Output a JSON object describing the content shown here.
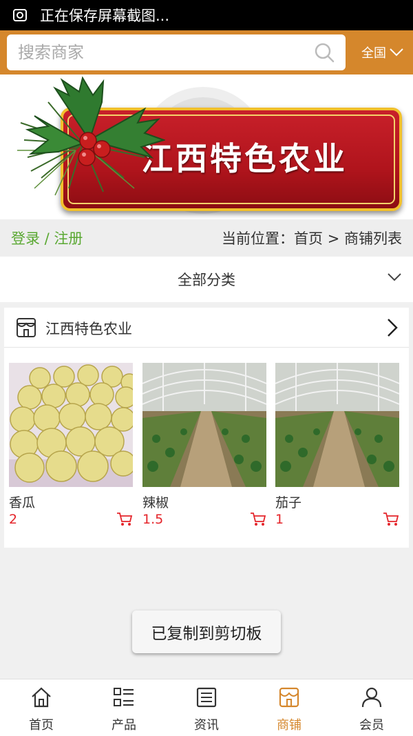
{
  "status_bar": {
    "text": "正在保存屏幕截图..."
  },
  "search": {
    "placeholder": "搜索商家"
  },
  "region": {
    "label": "全国"
  },
  "banner": {
    "title": "江西特色农业"
  },
  "location": {
    "login_label": "登录 / 注册",
    "breadcrumb": "当前位置：首页 > 商铺列表"
  },
  "category": {
    "label": "全部分类"
  },
  "shop": {
    "name": "江西特色农业",
    "products": [
      {
        "name": "香瓜",
        "price": "2"
      },
      {
        "name": "辣椒",
        "price": "1.5"
      },
      {
        "name": "茄子",
        "price": "1"
      }
    ]
  },
  "toast": {
    "text": "已复制到剪切板"
  },
  "nav": {
    "items": [
      {
        "label": "首页",
        "icon": "home-icon"
      },
      {
        "label": "产品",
        "icon": "list-icon"
      },
      {
        "label": "资讯",
        "icon": "news-icon"
      },
      {
        "label": "商铺",
        "icon": "store-icon"
      },
      {
        "label": "会员",
        "icon": "user-icon"
      }
    ],
    "active": "商铺"
  },
  "colors": {
    "brand": "#d5872c",
    "login_green": "#5aa832",
    "price_red": "#e4242a"
  }
}
